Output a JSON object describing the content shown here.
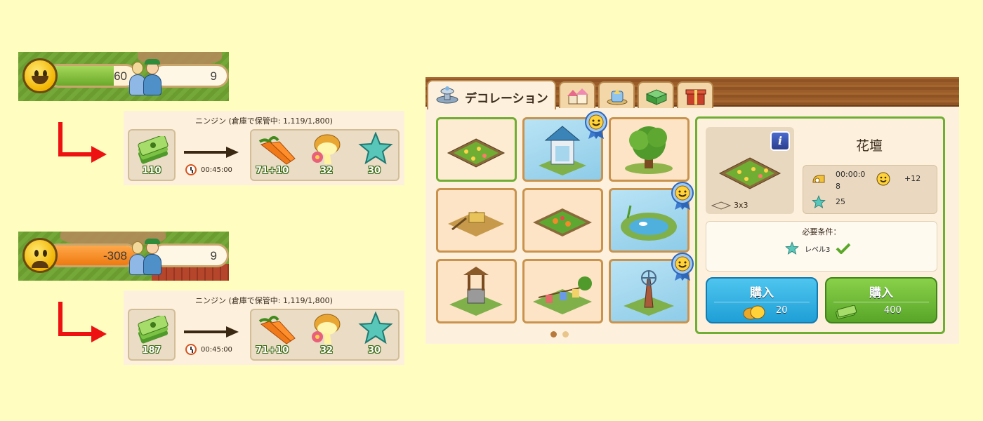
{
  "status_before": {
    "happiness": "60",
    "workers": "9",
    "mood": "happy"
  },
  "status_after": {
    "happiness": "-308",
    "workers": "9",
    "mood": "unhappy"
  },
  "recipe_before": {
    "title": "ニンジン (倉庫で保管中: 1,119/1,800)",
    "input_amount": "110",
    "time": "00:45:00",
    "outputs": [
      {
        "icon": "carrot-icon",
        "amount": "71+10"
      },
      {
        "icon": "flower-potion-icon",
        "amount": "32"
      },
      {
        "icon": "star-icon",
        "amount": "30"
      }
    ]
  },
  "recipe_after": {
    "title": "ニンジン (倉庫で保管中: 1,119/1,800)",
    "input_amount": "187",
    "time": "00:45:00",
    "outputs": [
      {
        "icon": "carrot-icon",
        "amount": "71+10"
      },
      {
        "icon": "flower-potion-icon",
        "amount": "32"
      },
      {
        "icon": "star-icon",
        "amount": "30"
      }
    ]
  },
  "shop": {
    "active_tab": "デコレーション",
    "tabs": [
      "decoration-tab",
      "houses-tab",
      "fountain-tab",
      "storage-tab",
      "gift-tab"
    ],
    "items": [
      {
        "name": "flowerbed-item",
        "bg": "plain",
        "badge": false,
        "selected": true
      },
      {
        "name": "gazebo-item",
        "bg": "blue",
        "badge": true
      },
      {
        "name": "oak-tree-item",
        "bg": "plain",
        "badge": false
      },
      {
        "name": "hay-bale-item",
        "bg": "plain",
        "badge": false
      },
      {
        "name": "vegetable-patch-item",
        "bg": "plain",
        "badge": false
      },
      {
        "name": "pond-item",
        "bg": "blue",
        "badge": true
      },
      {
        "name": "well-item",
        "bg": "plain",
        "badge": false
      },
      {
        "name": "laundry-line-item",
        "bg": "plain",
        "badge": false
      },
      {
        "name": "windmill-item",
        "bg": "blue",
        "badge": true
      }
    ],
    "page_count": 2,
    "current_page": 1
  },
  "details": {
    "name": "花壇",
    "size": "3x3",
    "time": "00:00:0\n8",
    "happiness": "+12",
    "xp": "25",
    "requirements_title": "必要条件：",
    "requirement": "レベル3",
    "buy_label": "購入",
    "coin_price": "20",
    "cash_price": "400"
  },
  "colors": {
    "background": "#fffdc0",
    "happy_fill": "#7cbd3c",
    "unhappy_fill": "#f08a1c",
    "arrow_red": "#ee1111",
    "selected_border": "#6fae33",
    "coin_button": "#1e9fd6",
    "cash_button": "#58a528"
  }
}
